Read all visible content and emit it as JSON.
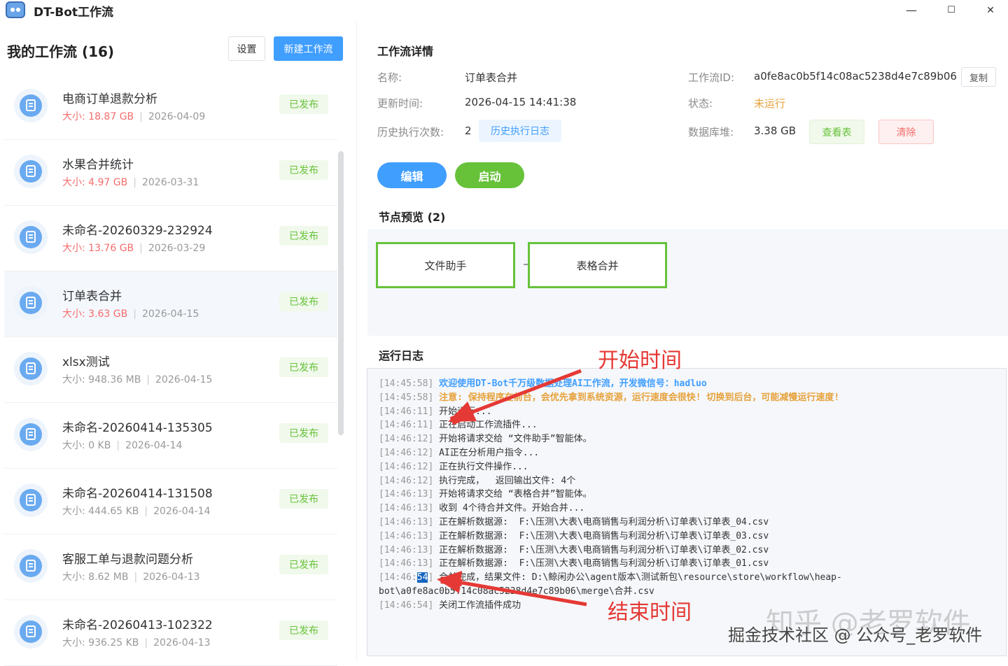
{
  "window": {
    "title": "DT-Bot工作流",
    "minimize": "—",
    "maximize": "☐",
    "close": "✕"
  },
  "sidebar": {
    "title": "我的工作流 (16)",
    "settings_label": "设置",
    "new_label": "新建工作流",
    "size_label": "大小:",
    "items": [
      {
        "name": "电商订单退款分析",
        "size": "18.87 GB",
        "date": "2026-04-09",
        "status": "已发布"
      },
      {
        "name": "水果合并统计",
        "size": "4.97 GB",
        "date": "2026-03-31",
        "status": "已发布"
      },
      {
        "name": "未命名-20260329-232924",
        "size": "13.76 GB",
        "date": "2026-03-29",
        "status": "已发布"
      },
      {
        "name": "订单表合并",
        "size": "3.63 GB",
        "date": "2026-04-15",
        "status": "已发布"
      },
      {
        "name": "xlsx测试",
        "size": "948.36 MB",
        "date": "2026-04-15",
        "status": "已发布"
      },
      {
        "name": "未命名-20260414-135305",
        "size": "0 KB",
        "date": "2026-04-14",
        "status": "已发布"
      },
      {
        "name": "未命名-20260414-131508",
        "size": "444.65 KB",
        "date": "2026-04-14",
        "status": "已发布"
      },
      {
        "name": "客服工单与退款问题分析",
        "size": "8.62 MB",
        "date": "2026-04-13",
        "status": "已发布"
      },
      {
        "name": "未命名-20260413-102322",
        "size": "936.25 KB",
        "date": "2026-04-13",
        "status": "已发布"
      }
    ]
  },
  "detail": {
    "title": "工作流详情",
    "name_label": "名称:",
    "name_value": "订单表合并",
    "updated_label": "更新时间:",
    "updated_value": "2026-04-15 14:41:38",
    "runs_label": "历史执行次数:",
    "runs_value": "2",
    "history_button": "历史执行日志",
    "id_label": "工作流ID:",
    "id_value": "a0fe8ac0b5f14c08ac5238d4e7c89b06",
    "copy_button": "复制",
    "status_label": "状态:",
    "status_value": "未运行",
    "db_label": "数据库堆:",
    "db_value": "3.38 GB",
    "view_button": "查看表",
    "clear_button": "清除",
    "edit_button": "编辑",
    "start_button": "启动"
  },
  "preview": {
    "title": "节点预览 (2)",
    "nodes": [
      "文件助手",
      "表格合并"
    ]
  },
  "log": {
    "title": "运行日志",
    "lines": [
      {
        "ts": "[14:45:58]",
        "msg": "欢迎使用DT-Bot千万级数据处理AI工作流，开发微信号：hadluo",
        "kind": "info"
      },
      {
        "ts": "[14:45:58]",
        "msg": "注意: 保持程序在前台，会优先拿到系统资源，运行速度会很快! 切换到后台，可能减慢运行速度!",
        "kind": "warn"
      },
      {
        "ts": "[14:46:11]",
        "msg": "开始运行...",
        "kind": "normal"
      },
      {
        "ts": "[14:46:11]",
        "msg": "正在启动工作流插件...",
        "kind": "normal"
      },
      {
        "ts": "[14:46:12]",
        "msg": "开始将请求交给 “文件助手”智能体。",
        "kind": "normal"
      },
      {
        "ts": "[14:46:12]",
        "msg": "AI正在分析用户指令...",
        "kind": "normal"
      },
      {
        "ts": "[14:46:12]",
        "msg": "正在执行文件操作...",
        "kind": "normal"
      },
      {
        "ts": "[14:46:12]",
        "msg": "执行完成，  返回输出文件: 4个",
        "kind": "normal"
      },
      {
        "ts": "[14:46:13]",
        "msg": "开始将请求交给 “表格合并”智能体。",
        "kind": "normal"
      },
      {
        "ts": "[14:46:13]",
        "msg": "收到 4个待合并文件。开始合并...",
        "kind": "normal"
      },
      {
        "ts": "[14:46:13]",
        "msg": "正在解析数据源:  F:\\压测\\大表\\电商销售与利润分析\\订单表\\订单表_04.csv",
        "kind": "normal"
      },
      {
        "ts": "[14:46:13]",
        "msg": "正在解析数据源:  F:\\压测\\大表\\电商销售与利润分析\\订单表\\订单表_03.csv",
        "kind": "normal"
      },
      {
        "ts": "[14:46:13]",
        "msg": "正在解析数据源:  F:\\压测\\大表\\电商销售与利润分析\\订单表\\订单表_02.csv",
        "kind": "normal"
      },
      {
        "ts": "[14:46:13]",
        "msg": "正在解析数据源:  F:\\压测\\大表\\电商销售与利润分析\\订单表\\订单表_01.csv",
        "kind": "normal"
      },
      {
        "ts_pre": "[14:46:",
        "ts_hl": "54",
        "ts_post": "]",
        "msg": "合并完成，结果文件: D:\\鲸闲办公\\agent版本\\测试新包\\resource\\store\\workflow\\heap-",
        "kind": "merged"
      },
      {
        "ts": "",
        "msg": "bot\\a0fe8ac0b5f14c08ac5238d4e7c89b06\\merge\\合并.csv",
        "kind": "cont"
      },
      {
        "ts": "[14:46:54]",
        "msg": "关闭工作流插件成功",
        "kind": "normal"
      }
    ]
  },
  "annotations": {
    "start_label": "开始时间",
    "end_label": "结束时间",
    "arrow_color": "#e53935"
  },
  "watermark": {
    "line1": "知乎 @老罗软件",
    "line2": "掘金技术社区 @ 公众号_老罗软件"
  },
  "colors": {
    "primary": "#409eff",
    "success": "#67c23a",
    "warning": "#e6a23c",
    "danger": "#f56c6c"
  }
}
